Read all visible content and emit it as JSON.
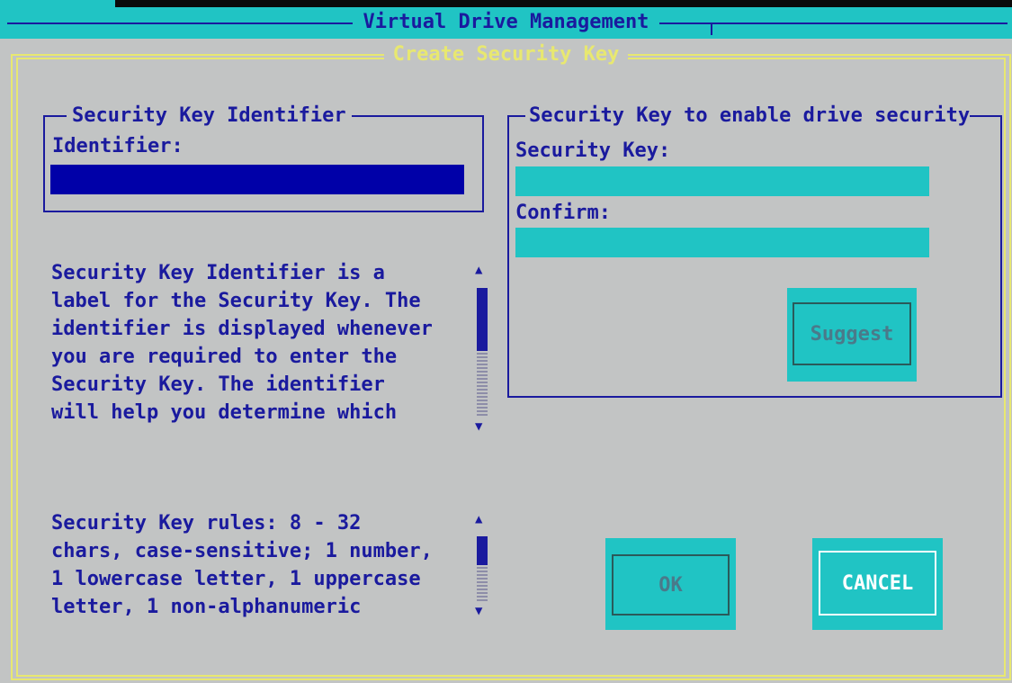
{
  "window": {
    "title": "Virtual Drive Management"
  },
  "dialog": {
    "title": "Create Security Key"
  },
  "identifier_group": {
    "title": "Security Key Identifier",
    "field_label": "Identifier:",
    "value": ""
  },
  "key_group": {
    "title": "Security Key to enable drive security",
    "key_label": "Security Key:",
    "key_value": "",
    "confirm_label": "Confirm:",
    "confirm_value": "",
    "suggest_label": "Suggest"
  },
  "help": {
    "identifier_text": "Security Key Identifier is a\nlabel for the Security Key. The\nidentifier is displayed whenever\nyou are required to enter the\nSecurity Key. The identifier\nwill help you determine which",
    "rules_text": "Security Key rules: 8 - 32\nchars, case-sensitive; 1 number,\n1 lowercase letter, 1 uppercase\nletter, 1 non-alphanumeric"
  },
  "buttons": {
    "ok_label": "OK",
    "cancel_label": "CANCEL"
  },
  "colors": {
    "background": "#c2c4c4",
    "accent_cyan": "#20c4c4",
    "text_blue": "#1a1a9e",
    "border_yellow": "#e8e870",
    "input_focus": "#0000a8"
  }
}
